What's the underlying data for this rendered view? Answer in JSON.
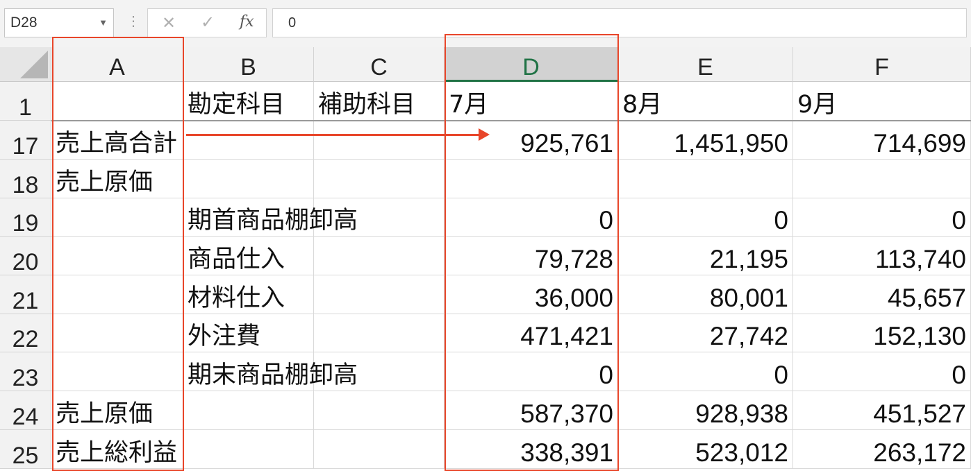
{
  "formula_bar": {
    "name_box": "D28",
    "separator": "⋮",
    "cancel_icon": "✕",
    "enter_icon": "✓",
    "fx_label": "fx",
    "formula": "0"
  },
  "columns": [
    "A",
    "B",
    "C",
    "D",
    "E",
    "F"
  ],
  "selected_column": "D",
  "rows": [
    {
      "row": "1",
      "A": "",
      "B": "勘定科目",
      "C": "補助科目",
      "D": "7月",
      "E": "8月",
      "F": "9月"
    },
    {
      "row": "17",
      "A": "売上高合計",
      "B": "",
      "C": "",
      "D": "925,761",
      "E": "1,451,950",
      "F": "714,699"
    },
    {
      "row": "18",
      "A": "売上原価",
      "B": "",
      "C": "",
      "D": "",
      "E": "",
      "F": ""
    },
    {
      "row": "19",
      "A": "",
      "B": "期首商品棚卸高",
      "C": "",
      "D": "0",
      "E": "0",
      "F": "0"
    },
    {
      "row": "20",
      "A": "",
      "B": "商品仕入",
      "C": "",
      "D": "79,728",
      "E": "21,195",
      "F": "113,740"
    },
    {
      "row": "21",
      "A": "",
      "B": "材料仕入",
      "C": "",
      "D": "36,000",
      "E": "80,001",
      "F": "45,657"
    },
    {
      "row": "22",
      "A": "",
      "B": "外注費",
      "C": "",
      "D": "471,421",
      "E": "27,742",
      "F": "152,130"
    },
    {
      "row": "23",
      "A": "",
      "B": "期末商品棚卸高",
      "C": "",
      "D": "0",
      "E": "0",
      "F": "0"
    },
    {
      "row": "24",
      "A": "売上原価",
      "B": "",
      "C": "",
      "D": "587,370",
      "E": "928,938",
      "F": "451,527"
    },
    {
      "row": "25",
      "A": "売上総利益",
      "B": "",
      "C": "",
      "D": "338,391",
      "E": "523,012",
      "F": "263,172"
    }
  ],
  "colors": {
    "accent_green": "#217346",
    "annotation_red": "#e8462a"
  }
}
